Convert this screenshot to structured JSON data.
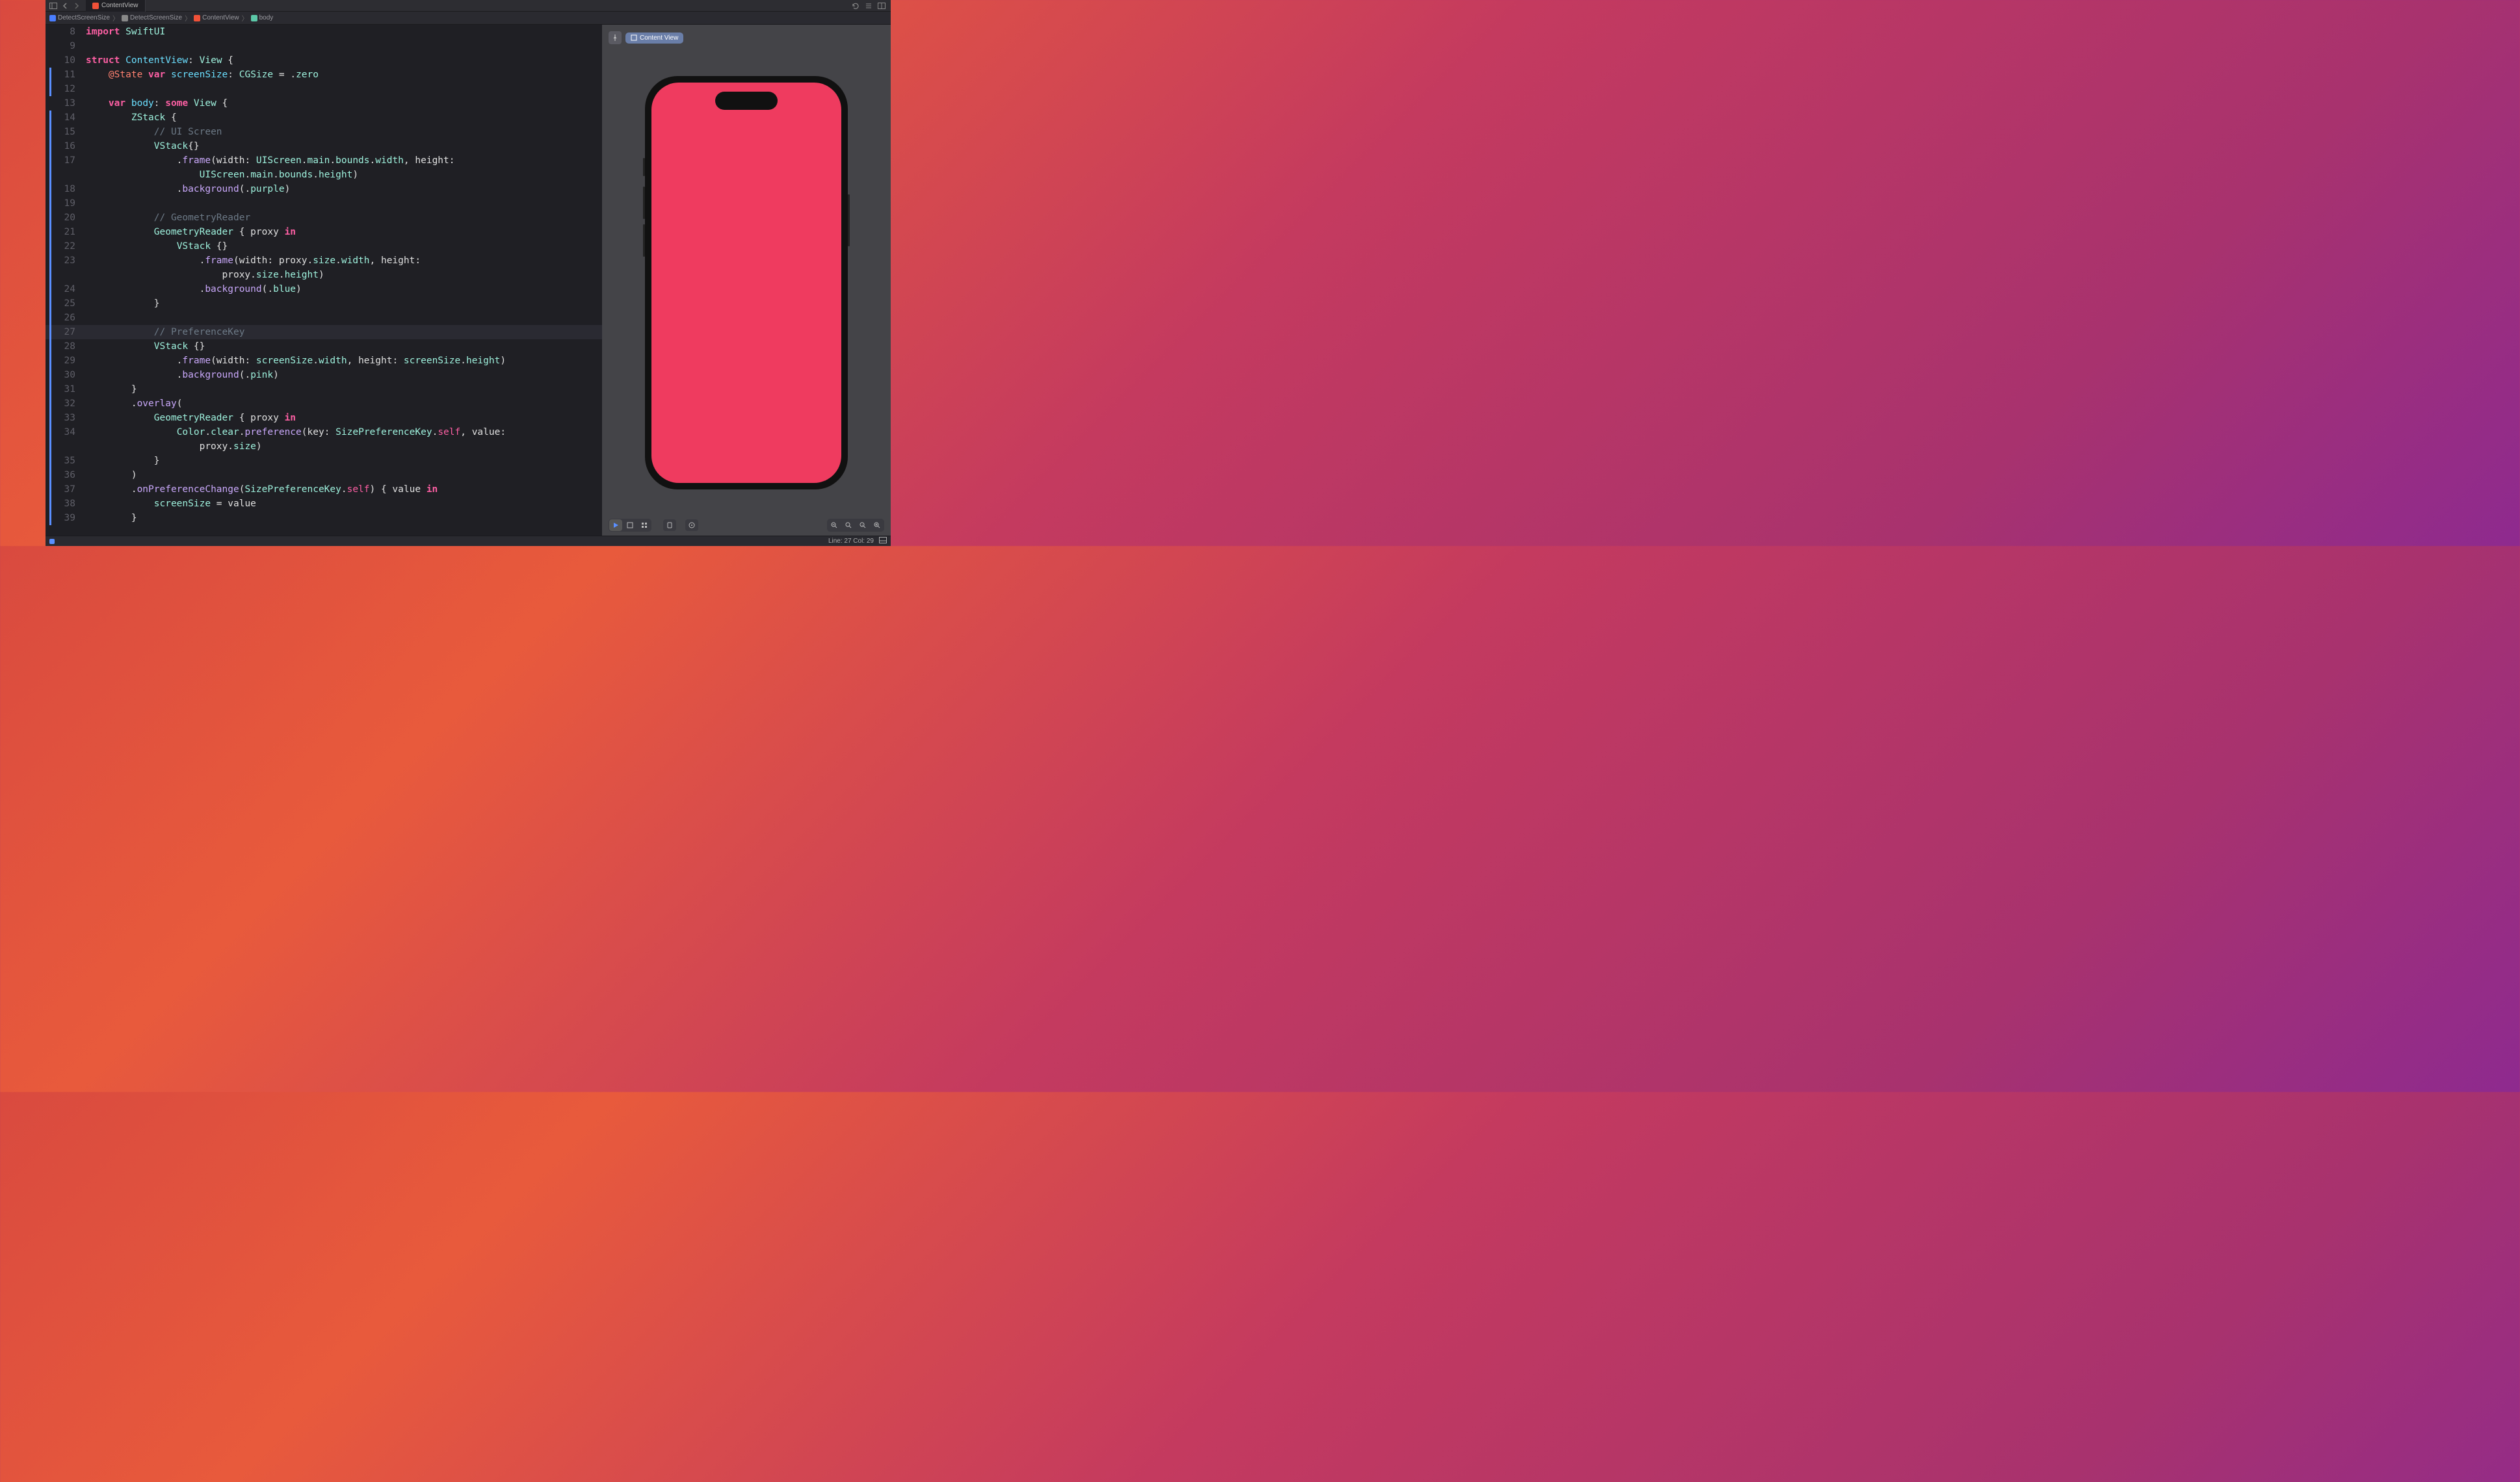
{
  "tab": {
    "title": "ContentView"
  },
  "breadcrumb": {
    "app": "DetectScreenSize",
    "folder": "DetectScreenSize",
    "file": "ContentView",
    "property": "body"
  },
  "code": {
    "lines": [
      {
        "n": 8,
        "bar": false,
        "tokens": [
          [
            "keyword",
            "import"
          ],
          [
            "plain",
            " "
          ],
          [
            "type",
            "SwiftUI"
          ]
        ]
      },
      {
        "n": 9,
        "bar": false,
        "tokens": []
      },
      {
        "n": 10,
        "bar": false,
        "tokens": [
          [
            "keyword",
            "struct"
          ],
          [
            "plain",
            " "
          ],
          [
            "typedecl",
            "ContentView"
          ],
          [
            "plain",
            ": "
          ],
          [
            "type",
            "View"
          ],
          [
            "plain",
            " {"
          ]
        ]
      },
      {
        "n": 11,
        "bar": true,
        "tokens": [
          [
            "plain",
            "    "
          ],
          [
            "attr",
            "@State"
          ],
          [
            "plain",
            " "
          ],
          [
            "keyword",
            "var"
          ],
          [
            "plain",
            " "
          ],
          [
            "var",
            "screenSize"
          ],
          [
            "plain",
            ": "
          ],
          [
            "type",
            "CGSize"
          ],
          [
            "plain",
            " = ."
          ],
          [
            "prop",
            "zero"
          ]
        ]
      },
      {
        "n": 12,
        "bar": true,
        "tokens": []
      },
      {
        "n": 13,
        "bar": false,
        "tokens": [
          [
            "plain",
            "    "
          ],
          [
            "keyword",
            "var"
          ],
          [
            "plain",
            " "
          ],
          [
            "var",
            "body"
          ],
          [
            "plain",
            ": "
          ],
          [
            "keyword",
            "some"
          ],
          [
            "plain",
            " "
          ],
          [
            "type",
            "View"
          ],
          [
            "plain",
            " {"
          ]
        ]
      },
      {
        "n": 14,
        "bar": true,
        "tokens": [
          [
            "plain",
            "        "
          ],
          [
            "type",
            "ZStack"
          ],
          [
            "plain",
            " {"
          ]
        ]
      },
      {
        "n": 15,
        "bar": true,
        "tokens": [
          [
            "plain",
            "            "
          ],
          [
            "comment",
            "// UI Screen"
          ]
        ]
      },
      {
        "n": 16,
        "bar": true,
        "tokens": [
          [
            "plain",
            "            "
          ],
          [
            "type",
            "VStack"
          ],
          [
            "plain",
            "{}"
          ]
        ]
      },
      {
        "n": 17,
        "bar": true,
        "tokens": [
          [
            "plain",
            "                ."
          ],
          [
            "func",
            "frame"
          ],
          [
            "plain",
            "(width: "
          ],
          [
            "type",
            "UIScreen"
          ],
          [
            "plain",
            "."
          ],
          [
            "prop",
            "main"
          ],
          [
            "plain",
            "."
          ],
          [
            "prop",
            "bounds"
          ],
          [
            "plain",
            "."
          ],
          [
            "prop",
            "width"
          ],
          [
            "plain",
            ", height: "
          ]
        ]
      },
      {
        "n": "",
        "bar": true,
        "tokens": [
          [
            "plain",
            "                    "
          ],
          [
            "type",
            "UIScreen"
          ],
          [
            "plain",
            "."
          ],
          [
            "prop",
            "main"
          ],
          [
            "plain",
            "."
          ],
          [
            "prop",
            "bounds"
          ],
          [
            "plain",
            "."
          ],
          [
            "prop",
            "height"
          ],
          [
            "plain",
            ")"
          ]
        ]
      },
      {
        "n": 18,
        "bar": true,
        "tokens": [
          [
            "plain",
            "                ."
          ],
          [
            "func",
            "background"
          ],
          [
            "plain",
            "(."
          ],
          [
            "prop",
            "purple"
          ],
          [
            "plain",
            ")"
          ]
        ]
      },
      {
        "n": 19,
        "bar": true,
        "tokens": []
      },
      {
        "n": 20,
        "bar": true,
        "tokens": [
          [
            "plain",
            "            "
          ],
          [
            "comment",
            "// GeometryReader"
          ]
        ]
      },
      {
        "n": 21,
        "bar": true,
        "tokens": [
          [
            "plain",
            "            "
          ],
          [
            "type",
            "GeometryReader"
          ],
          [
            "plain",
            " { proxy "
          ],
          [
            "keyword",
            "in"
          ]
        ]
      },
      {
        "n": 22,
        "bar": true,
        "tokens": [
          [
            "plain",
            "                "
          ],
          [
            "type",
            "VStack"
          ],
          [
            "plain",
            " {}"
          ]
        ]
      },
      {
        "n": 23,
        "bar": true,
        "tokens": [
          [
            "plain",
            "                    ."
          ],
          [
            "func",
            "frame"
          ],
          [
            "plain",
            "(width: proxy."
          ],
          [
            "prop",
            "size"
          ],
          [
            "plain",
            "."
          ],
          [
            "prop",
            "width"
          ],
          [
            "plain",
            ", height: "
          ]
        ]
      },
      {
        "n": "",
        "bar": true,
        "tokens": [
          [
            "plain",
            "                        proxy."
          ],
          [
            "prop",
            "size"
          ],
          [
            "plain",
            "."
          ],
          [
            "prop",
            "height"
          ],
          [
            "plain",
            ")"
          ]
        ]
      },
      {
        "n": 24,
        "bar": true,
        "tokens": [
          [
            "plain",
            "                    ."
          ],
          [
            "func",
            "background"
          ],
          [
            "plain",
            "(."
          ],
          [
            "prop",
            "blue"
          ],
          [
            "plain",
            ")"
          ]
        ]
      },
      {
        "n": 25,
        "bar": true,
        "tokens": [
          [
            "plain",
            "            }"
          ]
        ]
      },
      {
        "n": 26,
        "bar": true,
        "tokens": []
      },
      {
        "n": 27,
        "bar": true,
        "cur": true,
        "tokens": [
          [
            "plain",
            "            "
          ],
          [
            "comment",
            "// PreferenceKey"
          ]
        ]
      },
      {
        "n": 28,
        "bar": true,
        "tokens": [
          [
            "plain",
            "            "
          ],
          [
            "type",
            "VStack"
          ],
          [
            "plain",
            " {}"
          ]
        ]
      },
      {
        "n": 29,
        "bar": true,
        "tokens": [
          [
            "plain",
            "                ."
          ],
          [
            "func",
            "frame"
          ],
          [
            "plain",
            "(width: "
          ],
          [
            "prop",
            "screenSize"
          ],
          [
            "plain",
            "."
          ],
          [
            "prop",
            "width"
          ],
          [
            "plain",
            ", height: "
          ],
          [
            "prop",
            "screenSize"
          ],
          [
            "plain",
            "."
          ],
          [
            "prop",
            "height"
          ],
          [
            "plain",
            ")"
          ]
        ]
      },
      {
        "n": 30,
        "bar": true,
        "tokens": [
          [
            "plain",
            "                ."
          ],
          [
            "func",
            "background"
          ],
          [
            "plain",
            "(."
          ],
          [
            "prop",
            "pink"
          ],
          [
            "plain",
            ")"
          ]
        ]
      },
      {
        "n": 31,
        "bar": true,
        "tokens": [
          [
            "plain",
            "        }"
          ]
        ]
      },
      {
        "n": 32,
        "bar": true,
        "tokens": [
          [
            "plain",
            "        ."
          ],
          [
            "func",
            "overlay"
          ],
          [
            "plain",
            "("
          ]
        ]
      },
      {
        "n": 33,
        "bar": true,
        "tokens": [
          [
            "plain",
            "            "
          ],
          [
            "type",
            "GeometryReader"
          ],
          [
            "plain",
            " { proxy "
          ],
          [
            "keyword",
            "in"
          ]
        ]
      },
      {
        "n": 34,
        "bar": true,
        "tokens": [
          [
            "plain",
            "                "
          ],
          [
            "type",
            "Color"
          ],
          [
            "plain",
            "."
          ],
          [
            "prop",
            "clear"
          ],
          [
            "plain",
            "."
          ],
          [
            "func",
            "preference"
          ],
          [
            "plain",
            "(key: "
          ],
          [
            "type",
            "SizePreferenceKey"
          ],
          [
            "plain",
            "."
          ],
          [
            "self",
            "self"
          ],
          [
            "plain",
            ", value: "
          ]
        ]
      },
      {
        "n": "",
        "bar": true,
        "tokens": [
          [
            "plain",
            "                    proxy."
          ],
          [
            "prop",
            "size"
          ],
          [
            "plain",
            ")"
          ]
        ]
      },
      {
        "n": 35,
        "bar": true,
        "tokens": [
          [
            "plain",
            "            }"
          ]
        ]
      },
      {
        "n": 36,
        "bar": true,
        "tokens": [
          [
            "plain",
            "        )"
          ]
        ]
      },
      {
        "n": 37,
        "bar": true,
        "tokens": [
          [
            "plain",
            "        ."
          ],
          [
            "func",
            "onPreferenceChange"
          ],
          [
            "plain",
            "("
          ],
          [
            "type",
            "SizePreferenceKey"
          ],
          [
            "plain",
            "."
          ],
          [
            "self",
            "self"
          ],
          [
            "plain",
            ") { value "
          ],
          [
            "keyword",
            "in"
          ]
        ]
      },
      {
        "n": 38,
        "bar": true,
        "tokens": [
          [
            "plain",
            "            "
          ],
          [
            "prop",
            "screenSize"
          ],
          [
            "plain",
            " = value"
          ]
        ]
      },
      {
        "n": 39,
        "bar": true,
        "tokens": [
          [
            "plain",
            "        }"
          ]
        ]
      }
    ]
  },
  "canvas": {
    "chip_label": "Content View",
    "screen_color": "#ef3b5f"
  },
  "status": {
    "line_col": "Line: 27  Col: 29"
  }
}
